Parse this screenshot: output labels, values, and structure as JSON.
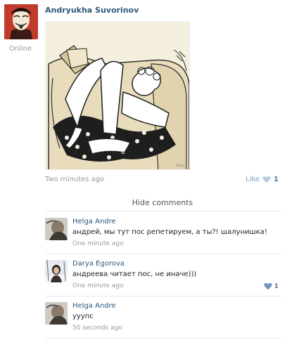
{
  "post": {
    "author": "Andryukha Suvorinov",
    "status": "Online",
    "time": "Two minutes ago",
    "like_label": "Like",
    "like_count": "1",
    "image_signature": "Basco"
  },
  "hide_comments": "Hide comments",
  "comments": [
    {
      "name": "Helga Andre",
      "text": "андрей, мы тут пос репетируем, а ты?! шалунишка!",
      "time": "One minute ago",
      "likes": ""
    },
    {
      "name": "Darya Egorova",
      "text": "андреева читает пос, не иначе)))",
      "time": "One minute ago",
      "likes": "1"
    },
    {
      "name": "Helga Andre",
      "text": "ууупс",
      "time": "50 seconds ago",
      "likes": ""
    }
  ],
  "colors": {
    "link": "#2b587a",
    "muted": "#999999",
    "like_icon": "#8fadcc",
    "divider": "#e4e8ed"
  }
}
